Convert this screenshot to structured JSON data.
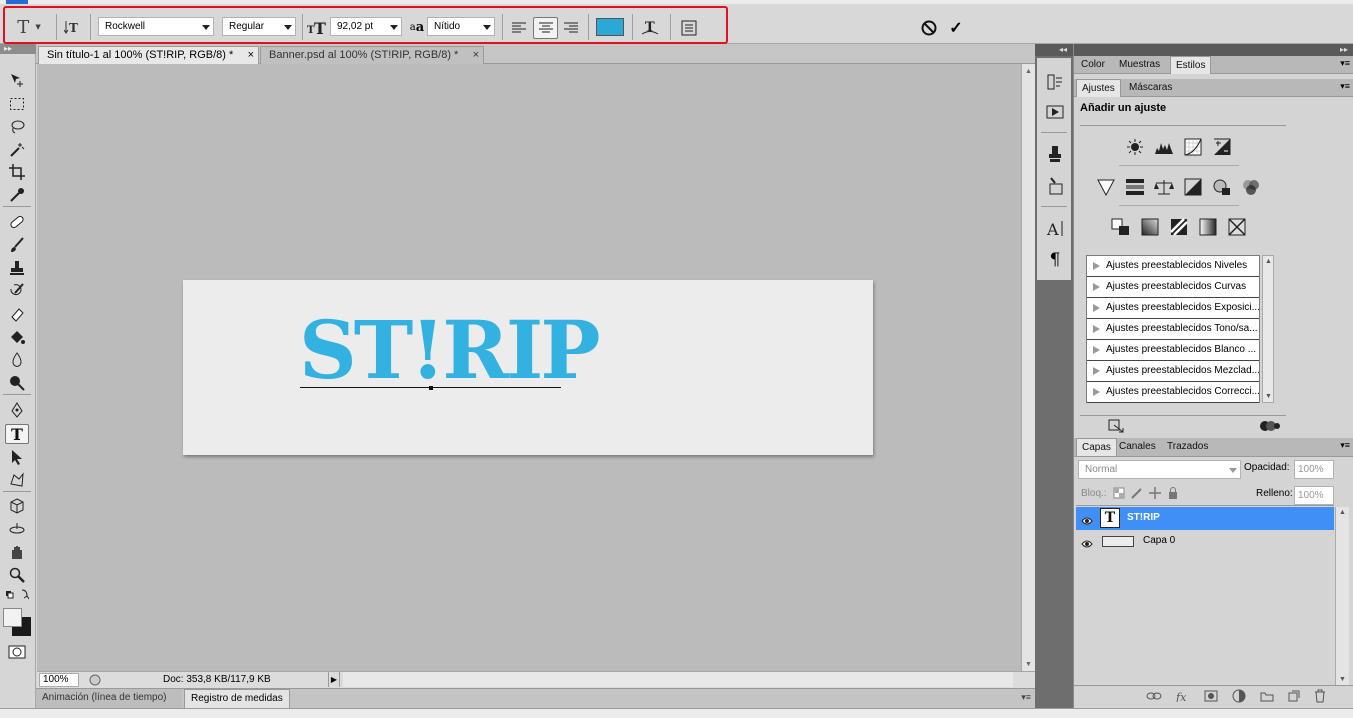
{
  "options_bar": {
    "tool_icon_label": "T",
    "font_family": "Rockwell",
    "font_style": "Regular",
    "font_size": "92,02 pt",
    "antialias_label": "a",
    "antialias_sub": "a",
    "antialias": "Nítido",
    "color": "#2aa8d8",
    "cancel_label": "⃠",
    "commit_label": "✓"
  },
  "document_tabs": [
    {
      "label": "Sin título-1 al 100% (ST!RIP, RGB/8) *",
      "close": "×"
    },
    {
      "label": "Banner.psd al 100% (ST!RIP, RGB/8) *",
      "close": "×"
    }
  ],
  "canvas": {
    "text": "ST!RIP",
    "text_color": "#33b1e0"
  },
  "status_bar": {
    "zoom": "100%",
    "doc_info": "Doc: 353,8 KB/117,9 KB"
  },
  "bottom_tabs": [
    "Animación (línea de tiempo)",
    "Registro de medidas"
  ],
  "panels": {
    "top_tabs": [
      "Color",
      "Muestras",
      "Estilos"
    ],
    "adjust_tabs": [
      "Ajustes",
      "Máscaras"
    ],
    "adjust_title": "Añadir un ajuste",
    "presets": [
      "Ajustes preestablecidos Niveles",
      "Ajustes preestablecidos Curvas",
      "Ajustes preestablecidos Exposici...",
      "Ajustes preestablecidos Tono/sa...",
      "Ajustes preestablecidos Blanco ...",
      "Ajustes preestablecidos Mezclad...",
      "Ajustes preestablecidos Correcci..."
    ],
    "layer_tabs": [
      "Capas",
      "Canales",
      "Trazados"
    ],
    "blend_mode": "Normal",
    "opacity_label": "Opacidad:",
    "opacity_value": "100%",
    "lock_label": "Bloq.:",
    "fill_label": "Relleno:",
    "fill_value": "100%",
    "layers": [
      {
        "name": "ST!RIP",
        "thumb": "T",
        "selected": true
      },
      {
        "name": "Capa 0",
        "selected": false
      }
    ]
  }
}
